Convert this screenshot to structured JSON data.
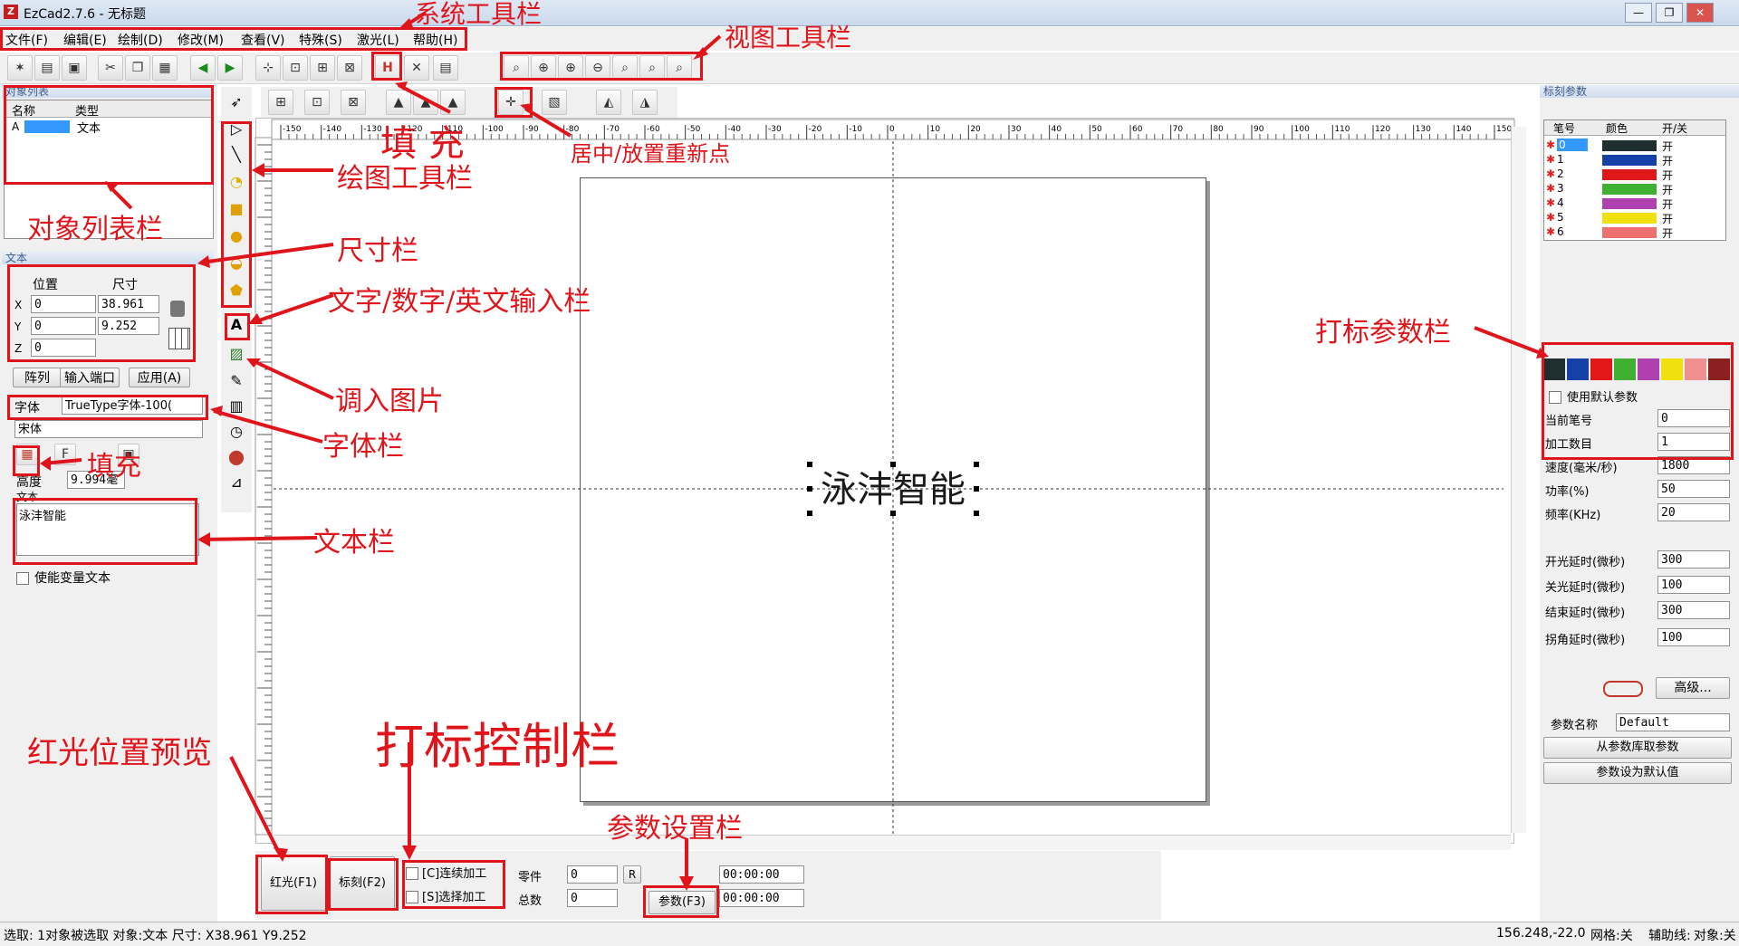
{
  "window": {
    "title": "EzCad2.7.6 - 无标题",
    "icon_letter": "Z",
    "controls": [
      "—",
      "❐",
      "✕"
    ]
  },
  "menu": [
    "文件(F)",
    "编辑(E)",
    "绘制(D)",
    "修改(M)",
    "查看(V)",
    "特殊(S)",
    "激光(L)",
    "帮助(H)"
  ],
  "toolbar_icons": [
    "new-icon",
    "open-icon",
    "save-icon",
    "cut-icon",
    "copy-icon",
    "paste-icon",
    "undo-icon",
    "redo-icon",
    "select-icon",
    "select2-icon",
    "select3-icon",
    "select4-icon",
    "hatch-icon",
    "tools-icon",
    "table-icon"
  ],
  "view_icons": [
    "zoom-icon",
    "zoom-in-icon",
    "zoom-in2-icon",
    "zoom-out-icon",
    "zoom-all-icon",
    "zoom-obj-icon",
    "zoom-sel-icon"
  ],
  "object_list": {
    "header": "对象列表",
    "col_name": "名称",
    "col_type": "类型",
    "row_letter": "A",
    "row_type": "文本"
  },
  "size_panel": {
    "header": "文本",
    "pos_label": "位置",
    "size_label": "尺寸",
    "x": "0",
    "y": "0",
    "z": "0",
    "w": "38.961",
    "h": "9.252",
    "x_lbl": "X",
    "y_lbl": "Y",
    "z_lbl": "Z"
  },
  "buttons": {
    "array": "阵列",
    "input_port": "输入端口",
    "apply": "应用(A)"
  },
  "font": {
    "label": "字体",
    "value": "TrueType字体-100(",
    "family": "宋体",
    "height_label": "高度",
    "height_value": "9.994毫"
  },
  "text_panel": {
    "label": "文本",
    "value": "泳沣智能",
    "var_text": "使能变量文本"
  },
  "canvas": {
    "text": "泳沣智能",
    "ruler_labels": [
      "-150",
      "-140",
      "-130",
      "-120",
      "-110",
      "-100",
      "-90",
      "-80",
      "-70",
      "-60",
      "-50",
      "-40",
      "-30",
      "-20",
      "-10",
      "0",
      "10",
      "20",
      "30",
      "40",
      "50",
      "60",
      "70",
      "80",
      "90",
      "100",
      "110",
      "120",
      "130",
      "140",
      "150"
    ]
  },
  "mark_params": {
    "header": "标刻参数",
    "col_pen": "笔号",
    "col_color": "颜色",
    "col_onoff": "开/关",
    "pens": [
      {
        "no": "0",
        "color": "#1f2e2e",
        "on": "开"
      },
      {
        "no": "1",
        "color": "#1540a8",
        "on": "开"
      },
      {
        "no": "2",
        "color": "#e01818",
        "on": "开"
      },
      {
        "no": "3",
        "color": "#40b030",
        "on": "开"
      },
      {
        "no": "4",
        "color": "#b040b0",
        "on": "开"
      },
      {
        "no": "5",
        "color": "#f0e010",
        "on": "开"
      },
      {
        "no": "6",
        "color": "#f07070",
        "on": "开"
      }
    ],
    "swatches": [
      "#1f2e2e",
      "#1540a8",
      "#e01818",
      "#40b030",
      "#b040b0",
      "#f0e010",
      "#f09090",
      "#8a2020"
    ],
    "use_default": "使用默认参数",
    "current_pen_label": "当前笔号",
    "current_pen": "0",
    "count_label": "加工数目",
    "count": "1",
    "speed_label": "速度(毫米/秒)",
    "speed": "1800",
    "power_label": "功率(%)",
    "power": "50",
    "freq_label": "频率(KHz)",
    "freq": "20",
    "on_delay_label": "开光延时(微秒)",
    "on_delay": "300",
    "off_delay_label": "关光延时(微秒)",
    "off_delay": "100",
    "end_delay_label": "结束延时(微秒)",
    "end_delay": "300",
    "corner_delay_label": "拐角延时(微秒)",
    "corner_delay": "100",
    "advanced": "高级...",
    "param_name_label": "参数名称",
    "param_name": "Default",
    "from_lib": "从参数库取参数",
    "set_default": "参数设为默认值"
  },
  "bottom": {
    "red": "红光(F1)",
    "mark": "标刻(F2)",
    "continuous": "[C]连续加工",
    "select": "[S]选择加工",
    "part_label": "零件",
    "part": "0",
    "total_label": "总数",
    "total": "0",
    "r": "R",
    "time1": "00:00:00",
    "time2": "00:00:00",
    "param": "参数(F3)"
  },
  "status": {
    "left": "选取: 1对象被选取 对象:文本 尺寸: X38.961 Y9.252",
    "coords": "156.248,-22.0",
    "grid": "网格:关",
    "aux": "辅助线:",
    "obj": "对象:关"
  },
  "annotations": {
    "sys_toolbar": "系统工具栏",
    "view_toolbar": "视图工具栏",
    "fill1": "填 充",
    "center": "居中/放置重新点",
    "draw_toolbar": "绘图工具栏",
    "obj_list": "对象列表栏",
    "size_bar": "尺寸栏",
    "text_input": "文字/数字/英文输入栏",
    "import_img": "调入图片",
    "font_bar": "字体栏",
    "fill2": "填充",
    "text_bar": "文本栏",
    "red_preview": "红光位置预览",
    "mark_ctrl": "打标控制栏",
    "param_set": "参数设置栏",
    "mark_param": "打标参数栏"
  },
  "colors": {
    "annotation": "#e0151b",
    "selection": "#3399ff"
  }
}
